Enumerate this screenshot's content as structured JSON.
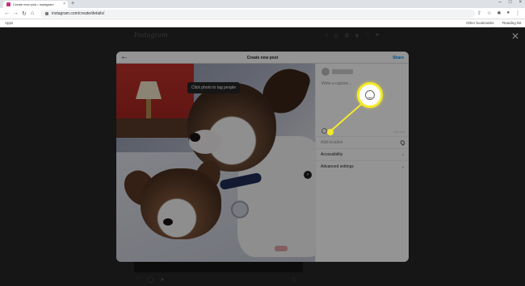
{
  "browser": {
    "tab_title": "Create new post • Instagram",
    "new_tab_glyph": "+",
    "url": "instagram.com/create/details/",
    "bookmarks_apps": "Apps",
    "bookmarks_other": "Other bookmarks",
    "bookmarks_reading": "Reading list"
  },
  "background_page": {
    "logo": "Instagram"
  },
  "modal": {
    "title": "Create new post",
    "share_label": "Share",
    "tooltip": "Click photo to tag people",
    "caption_placeholder": "Write a caption...",
    "char_counter": "0/2,200",
    "rows": [
      {
        "label": "Add location",
        "icon": "location-pin-icon"
      },
      {
        "label": "Accessibility",
        "icon": "chevron-down-icon"
      },
      {
        "label": "Advanced settings",
        "icon": "chevron-down-icon"
      }
    ]
  },
  "annotation": {
    "highlight_color": "#f5ea2a",
    "highlighted_icon": "emoji-smiley-icon"
  }
}
